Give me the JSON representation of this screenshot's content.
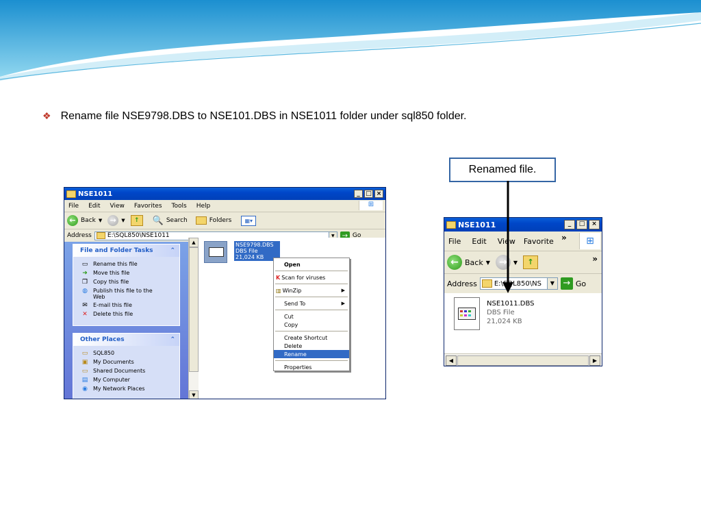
{
  "bullet_text": "Rename file NSE9798.DBS to NSE101.DBS in NSE1011 folder under sql850 folder.",
  "callout_text": "Renamed file.",
  "accent_colors": {
    "xp_title": "#0046c8",
    "callout_border": "#3465a4",
    "bullet": "#c0392b",
    "selection": "#316ac5"
  },
  "left_window": {
    "title": "NSE1011",
    "menu": [
      "File",
      "Edit",
      "View",
      "Favorites",
      "Tools",
      "Help"
    ],
    "toolbar": {
      "back": "Back",
      "search": "Search",
      "folders": "Folders"
    },
    "address_label": "Address",
    "address_value": "E:\\SQL850\\NSE1011",
    "go_label": "Go",
    "file_tasks": {
      "title": "File and Folder Tasks",
      "items": [
        "Rename this file",
        "Move this file",
        "Copy this file",
        "Publish this file to the Web",
        "E-mail this file",
        "Delete this file"
      ]
    },
    "other_places": {
      "title": "Other Places",
      "items": [
        "SQL850",
        "My Documents",
        "Shared Documents",
        "My Computer",
        "My Network Places"
      ]
    },
    "file": {
      "name": "NSE9798.DBS",
      "type": "DBS File",
      "size": "21,024 KB"
    },
    "context_menu": [
      "Open",
      "Scan for viruses",
      "WinZip",
      "Send To",
      "Cut",
      "Copy",
      "Create Shortcut",
      "Delete",
      "Rename",
      "Properties"
    ]
  },
  "right_window": {
    "title": "NSE1011",
    "menu": [
      "File",
      "Edit",
      "View",
      "Favorite"
    ],
    "toolbar": {
      "back": "Back"
    },
    "address_label": "Address",
    "address_value": "E:\\SQL850\\NS",
    "go_label": "Go",
    "file": {
      "name": "NSE1011.DBS",
      "type": "DBS File",
      "size": "21,024 KB"
    }
  }
}
